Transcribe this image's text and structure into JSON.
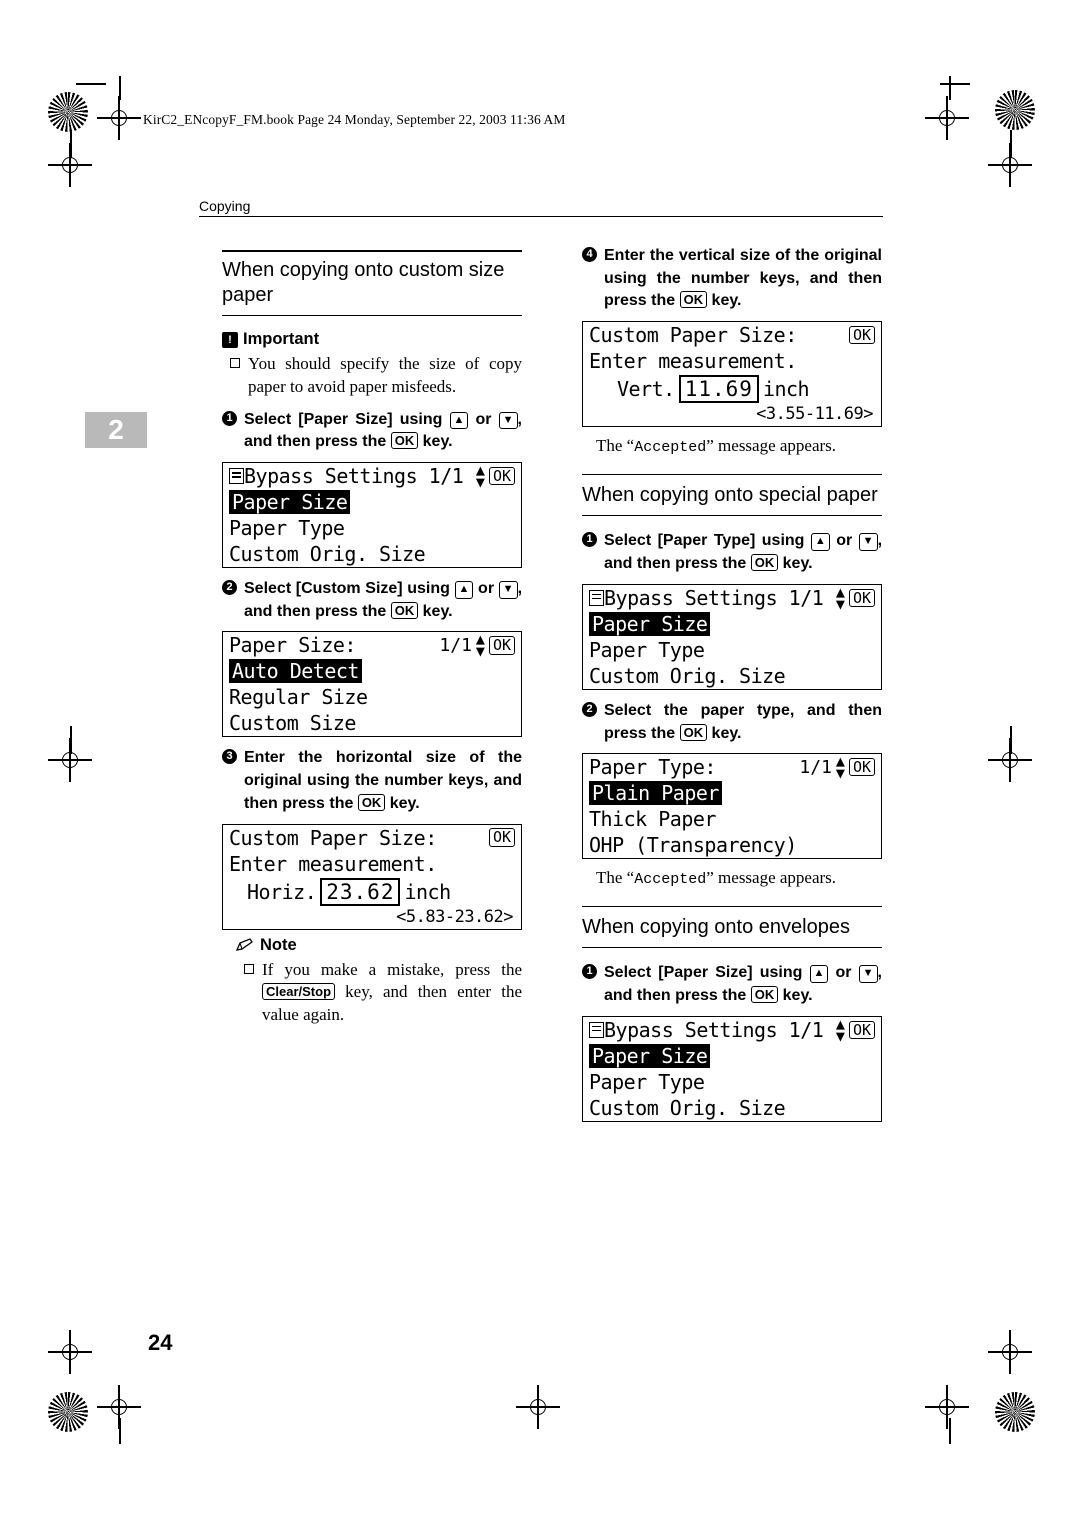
{
  "header": {
    "file_line": "KirC2_ENcopyF_FM.book  Page 24  Monday, September 22, 2003  11:36 AM",
    "running_head": "Copying",
    "chapter_tab": "2",
    "page_number": "24"
  },
  "left_column": {
    "section_title": "When copying onto custom size paper",
    "important_label": "Important",
    "important_text": "You should specify the size of copy paper to avoid paper misfeeds.",
    "step1": "Select [Paper Size] using [▲] or [▼], and then press the [OK] key.",
    "lcd1": {
      "title": "Bypass Settings 1/1",
      "ok": "OK",
      "items": [
        "Paper Size",
        "Paper Type",
        "Custom Orig. Size"
      ],
      "selected": "Paper Size"
    },
    "step2": "Select [Custom Size] using [▲] or [▼], and then press the [OK] key.",
    "lcd2": {
      "title": "Paper Size:",
      "page": "1/1",
      "ok": "OK",
      "items": [
        "Auto Detect",
        "Regular Size",
        "Custom Size"
      ],
      "selected": "Auto Detect"
    },
    "step3": "Enter the horizontal size of the original using the number keys, and then press the [OK] key.",
    "lcd3": {
      "title": "Custom Paper Size:",
      "ok": "OK",
      "prompt": "Enter measurement.",
      "field_label": "Horiz.",
      "value": "23.62",
      "unit": "inch",
      "range": "<5.83-23.62>"
    },
    "note_label": "Note",
    "note_text": "If you make a mistake, press the [Clear/Stop] key, and then enter the value again.",
    "clear_stop_key": "Clear/Stop"
  },
  "right_column": {
    "step4": "Enter the vertical size of the original using the number keys, and then press the [OK] key.",
    "lcd4": {
      "title": "Custom Paper Size:",
      "ok": "OK",
      "prompt": "Enter measurement.",
      "field_label": "Vert.",
      "value": "11.69",
      "unit": "inch",
      "range": "<3.55-11.69>"
    },
    "accepted_1": "The “Accepted” message appears.",
    "accepted_word": "Accepted",
    "section_special": "When copying onto special paper",
    "special_step1": "Select [Paper Type] using [▲] or [▼], and then press the [OK] key.",
    "lcd5": {
      "title": "Bypass Settings 1/1",
      "ok": "OK",
      "items": [
        "Paper Size",
        "Paper Type",
        "Custom Orig. Size"
      ],
      "selected": "Paper Size"
    },
    "special_step2": "Select the paper type, and then press the [OK] key.",
    "lcd6": {
      "title": "Paper Type:",
      "page": "1/1",
      "ok": "OK",
      "items": [
        "Plain Paper",
        "Thick Paper",
        "OHP (Transparency)"
      ],
      "selected": "Plain Paper"
    },
    "accepted_2": "The “Accepted” message appears.",
    "section_envelopes": "When copying onto envelopes",
    "env_step1": "Select [Paper Size] using [▲] or [▼], and then press the [OK] key.",
    "lcd7": {
      "title": "Bypass Settings 1/1",
      "ok": "OK",
      "items": [
        "Paper Size",
        "Paper Type",
        "Custom Orig. Size"
      ],
      "selected": "Paper Size"
    }
  }
}
